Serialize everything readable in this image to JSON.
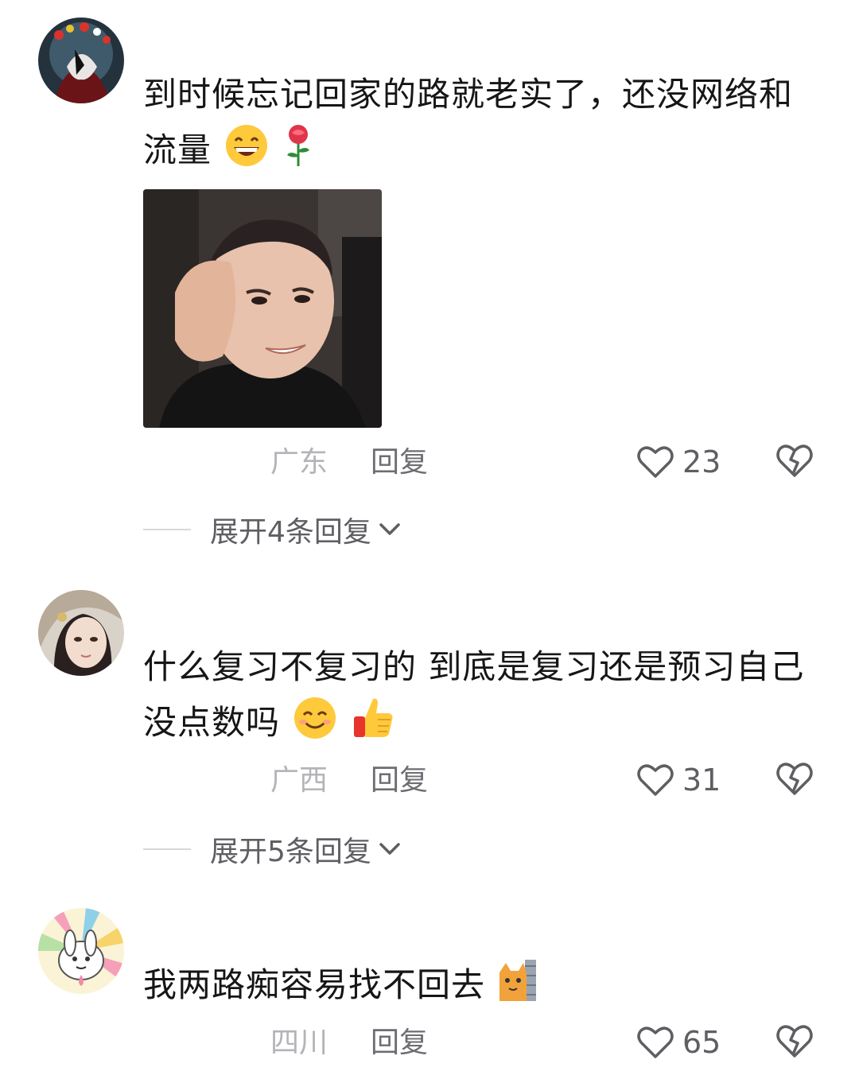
{
  "comments": [
    {
      "text": "到时候忘记回家的路就老实了，还没网络和流量",
      "emojis": [
        "grinning-face-emoji",
        "rose-emoji"
      ],
      "has_image": true,
      "location": "广东",
      "reply_label": "回复",
      "likes": "23",
      "expand_label": "展开4条回复"
    },
    {
      "text": "什么复习不复习的 到底是复习还是预习自己没点数吗",
      "emojis": [
        "smiling-face-emoji",
        "thumbs-up-emoji"
      ],
      "has_image": false,
      "location": "广西",
      "reply_label": "回复",
      "likes": "31",
      "expand_label": "展开5条回复"
    },
    {
      "text": "我两路痴容易找不回去",
      "emojis": [
        "cat-peeking-emoji"
      ],
      "has_image": false,
      "location": "四川",
      "reply_label": "回复",
      "likes": "65"
    }
  ],
  "colors": {
    "text": "#161616",
    "location": "#b4b4b8",
    "reply": "#6d6d73",
    "count": "#5e5e63",
    "divider": "#d8d8dc"
  }
}
